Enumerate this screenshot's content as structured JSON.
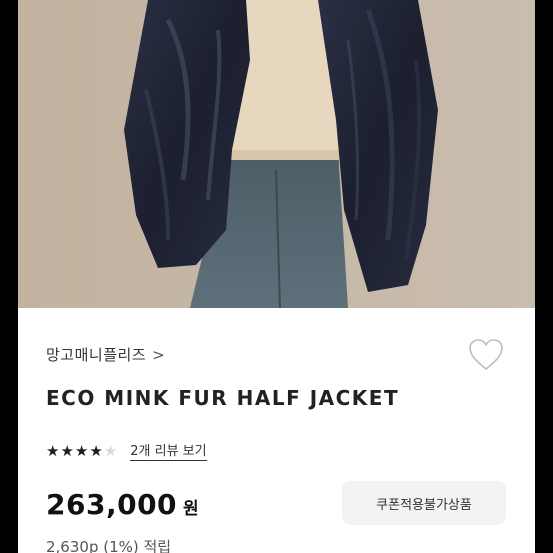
{
  "product": {
    "brand": "망고매니플리즈",
    "brand_chevron": ">",
    "title": "ECO MINK FUR HALF JACKET",
    "rating": 4,
    "rating_max": 5,
    "review_link": "2개 리뷰 보기",
    "price": "263,000",
    "price_unit": "원",
    "coupon_label": "쿠폰적용불가상품",
    "points": "2,630p (1%) 적립"
  },
  "icons": {
    "wishlist": "heart-outline-icon",
    "star": "star-icon"
  },
  "colors": {
    "photo_background": "#c5b8a6",
    "jacket": "#1e2233",
    "star_filled": "#1c1c1c",
    "star_empty": "#d9d9d9"
  }
}
